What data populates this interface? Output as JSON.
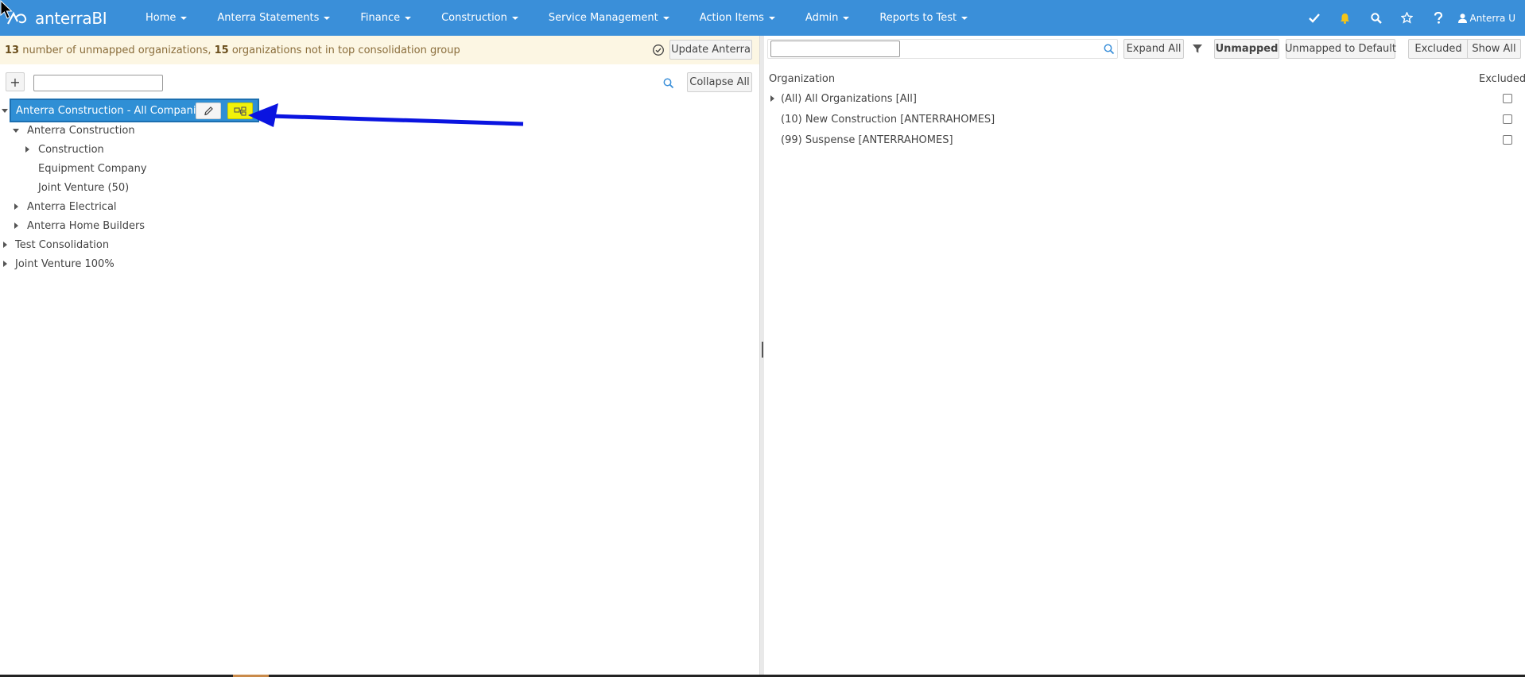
{
  "brand": {
    "name": "anterraBI",
    "logo_icon": "anterra-logo-icon"
  },
  "nav": {
    "items": [
      {
        "label": "Home"
      },
      {
        "label": "Anterra Statements"
      },
      {
        "label": "Finance"
      },
      {
        "label": "Construction"
      },
      {
        "label": "Service Management"
      },
      {
        "label": "Action Items"
      },
      {
        "label": "Admin"
      },
      {
        "label": "Reports to Test"
      }
    ],
    "icons": [
      "check-icon",
      "bell-icon",
      "search-icon",
      "star-icon",
      "help-icon"
    ],
    "user_label": "Anterra U",
    "bell_color": "#f5c518",
    "bar_color": "#3a8fd9"
  },
  "notice": {
    "unmapped_count": "13",
    "unmapped_text": " number of unmapped organizations, ",
    "not_top_count": "15",
    "not_top_text": " organizations not in top consolidation group",
    "update_label": "Update Anterra"
  },
  "tree_toolbar": {
    "add_label": "+",
    "search_value": "",
    "collapse_label": "Collapse All"
  },
  "tree": {
    "selected": "Anterra Construction - All Companies",
    "nodes": [
      {
        "label": "Anterra Construction"
      },
      {
        "label": "Construction"
      },
      {
        "label": "Equipment Company"
      },
      {
        "label": "Joint Venture (50)"
      },
      {
        "label": "Anterra Electrical"
      },
      {
        "label": "Anterra Home Builders"
      },
      {
        "label": "Test Consolidation"
      },
      {
        "label": "Joint Venture 100%"
      }
    ]
  },
  "right": {
    "search_value": "",
    "expand_label": "Expand All",
    "filters": {
      "unmapped": "Unmapped",
      "unmapped_to_default": "Unmapped to Default",
      "excluded": "Excluded",
      "show_all": "Show All"
    },
    "columns": {
      "organization": "Organization",
      "excluded": "Excluded"
    },
    "rows": [
      {
        "label": "(All) All Organizations [All]",
        "excluded": false
      },
      {
        "label": "(10) New Construction [ANTERRAHOMES]",
        "excluded": false
      },
      {
        "label": "(99) Suspense [ANTERRAHOMES]",
        "excluded": false
      }
    ]
  },
  "annotation": {
    "arrow_color": "#0a14e0",
    "highlight_color": "#f2f20a"
  }
}
